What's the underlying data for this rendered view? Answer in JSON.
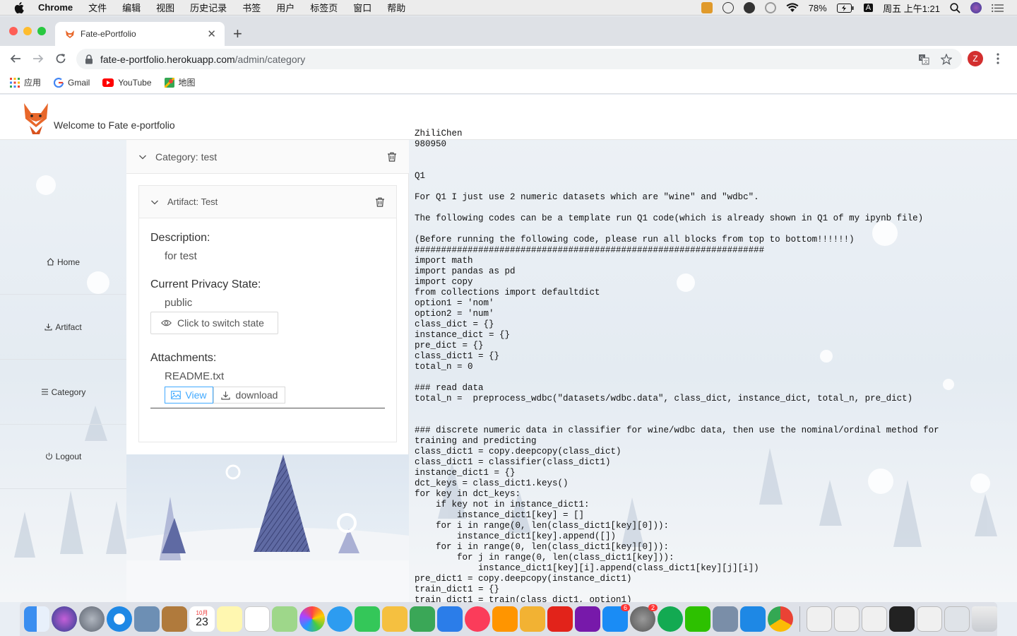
{
  "menubar": {
    "app_name": "Chrome",
    "items": [
      "文件",
      "编辑",
      "视图",
      "历史记录",
      "书签",
      "用户",
      "标签页",
      "窗口",
      "帮助"
    ],
    "battery": "78%",
    "input_method": "A",
    "clock": "周五 上午1:21"
  },
  "browser": {
    "tab_title": "Fate-ePortfolio",
    "url_host": "fate-e-portfolio.herokuapp.com",
    "url_path": "/admin/category",
    "profile_initial": "Z",
    "bookmarks": [
      "应用",
      "Gmail",
      "YouTube",
      "地图"
    ]
  },
  "header": {
    "welcome": "Welcome to Fate e-portfolio"
  },
  "sidebar": {
    "items": [
      {
        "label": "Home",
        "icon": "home-icon"
      },
      {
        "label": "Artifact",
        "icon": "download-icon"
      },
      {
        "label": "Category",
        "icon": "menu-icon"
      },
      {
        "label": "Logout",
        "icon": "power-icon"
      }
    ]
  },
  "category": {
    "header": "Category: test",
    "artifact": {
      "header": "Artifact: Test",
      "description_label": "Description:",
      "description": "for test",
      "privacy_label": "Current Privacy State:",
      "privacy_state": "public",
      "switch_label": "Click to switch state",
      "attachments_label": "Attachments:",
      "filename": "README.txt",
      "view_label": "View",
      "download_label": "download"
    }
  },
  "file_text": "ZhiliChen\n980950\n\n\nQ1\n\nFor Q1 I just use 2 numeric datasets which are \"wine\" and \"wdbc\".\n\nThe following codes can be a template run Q1 code(which is already shown in Q1 of my ipynb file)\n\n(Before running the following code, please run all blocks from top to bottom!!!!!!)\n##################################################################\nimport math\nimport pandas as pd\nimport copy\nfrom collections import defaultdict\noption1 = 'nom'\noption2 = 'num'\nclass_dict = {}\ninstance_dict = {}\npre_dict = {}\nclass_dict1 = {}\ntotal_n = 0\n\n### read data\ntotal_n =  preprocess_wdbc(\"datasets/wdbc.data\", class_dict, instance_dict, total_n, pre_dict)\n\n\n### discrete numeric data in classifier for wine/wdbc data, then use the nominal/ordinal method for\ntraining and predicting\nclass_dict1 = copy.deepcopy(class_dict)\nclass_dict1 = classifier(class_dict1)\ninstance_dict1 = {}\ndct_keys = class_dict1.keys()\nfor key in dct_keys:\n    if key not in instance_dict1:\n        instance_dict1[key] = []\n    for i in range(0, len(class_dict1[key][0])):\n        instance_dict1[key].append([])\n    for i in range(0, len(class_dict1[key][0])):\n        for j in range(0, len(class_dict1[key])):\n            instance_dict1[key][i].append(class_dict1[key][j][i])\npre_dict1 = copy.deepcopy(instance_dict1)\ntrain_dict1 = {}\ntrain_dict1 = train(class_dict1, option1)",
  "dock": {
    "calendar_month": "10月",
    "calendar_day": "23",
    "badges": {
      "app_store": "6",
      "settings": "2"
    }
  }
}
